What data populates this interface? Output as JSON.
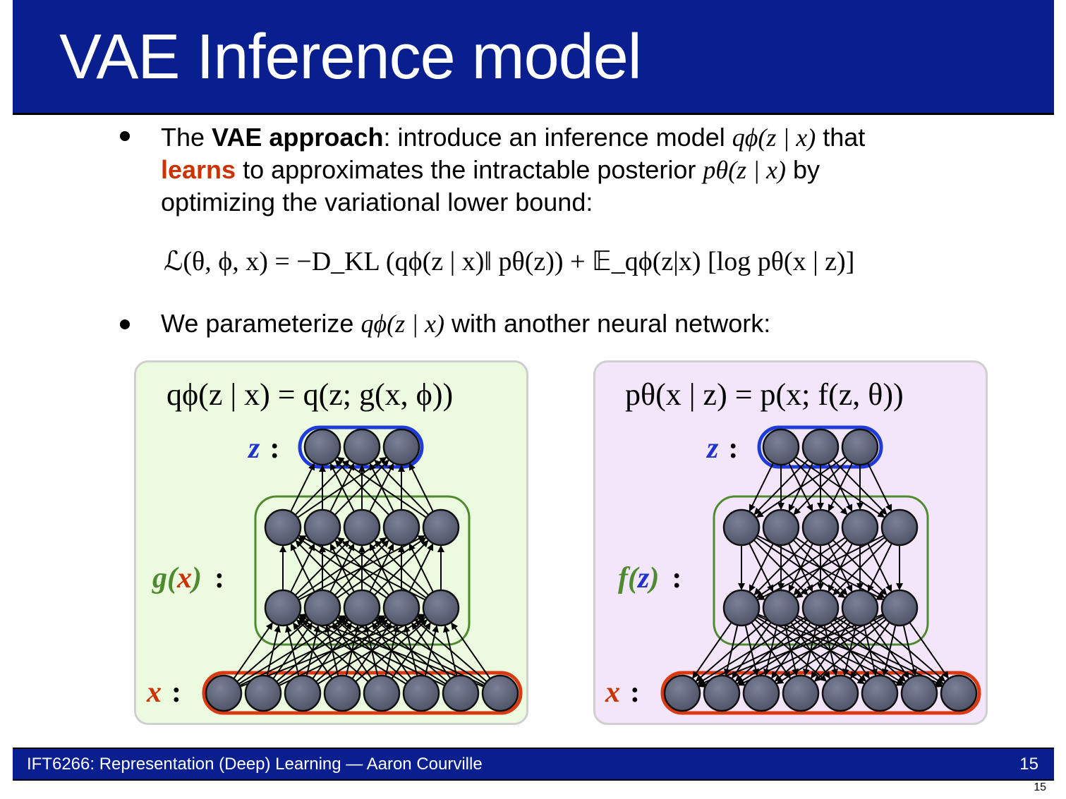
{
  "slide": {
    "title": "VAE Inference model",
    "bullet1": {
      "prefix": "The ",
      "bold": "VAE approach",
      "after_bold": ": introduce an inference model ",
      "math1": "qϕ(z | x)",
      "after_math1": " that",
      "learns": "learns",
      "after_learns": " to approximates the intractable posterior ",
      "math2": "pθ(z | x)",
      "after_math2": " by",
      "line3": "optimizing the variational lower bound:"
    },
    "equation": "ℒ(θ, ϕ, x) = −D_KL (qϕ(z | x)‖ pθ(z)) + 𝔼_qϕ(z|x) [log pθ(x | z)]",
    "bullet2": {
      "prefix": "We parameterize ",
      "math": "qϕ(z | x)",
      "suffix": " with another neural network:"
    }
  },
  "left_panel": {
    "formula": "qϕ(z | x) = q(z; g(x, ϕ))",
    "z_label": "z",
    "g_label_prefix": "g(",
    "g_label_x": "x",
    "g_label_suffix": ")",
    "x_label": "x",
    "colon": ":",
    "background": "#ecfbe0"
  },
  "right_panel": {
    "formula": "pθ(x | z) = p(x; f(z, θ))",
    "z_label": "z",
    "f_label_prefix": "f(",
    "f_label_z": "z",
    "f_label_suffix": ")",
    "x_label": "x",
    "colon": ":",
    "background": "#f3e6fb"
  },
  "network": {
    "layer_sizes": [
      8,
      5,
      5,
      3
    ],
    "node_color": "#5a6075",
    "z_box_color": "#1f3bd8",
    "hidden_box_color": "#4e8a2e",
    "x_box_color": "#d93a14"
  },
  "colors": {
    "title_bar": "#0a1f8f",
    "z_label": "#2233cc",
    "x_label": "#cc3300",
    "fn_label": "#4e8a2e",
    "learns": "#cc3300"
  },
  "footer": {
    "text": "IFT6266: Representation (Deep) Learning  —  Aaron Courville",
    "page": "15",
    "page_small": "15"
  }
}
